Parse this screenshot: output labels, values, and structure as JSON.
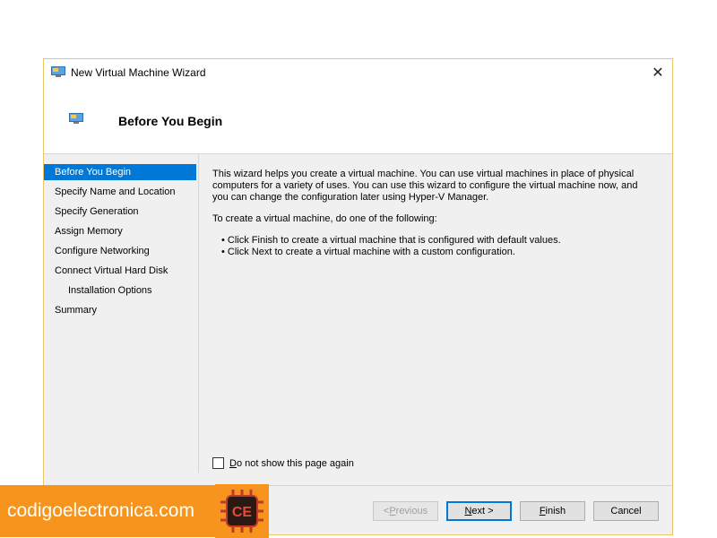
{
  "window": {
    "title": "New Virtual Machine Wizard",
    "close_glyph": "✕",
    "title_icon": "monitor-icon"
  },
  "header": {
    "title": "Before You Begin",
    "icon": "monitor-icon"
  },
  "steps": [
    {
      "label": "Before You Begin",
      "active": true
    },
    {
      "label": "Specify Name and Location"
    },
    {
      "label": "Specify Generation"
    },
    {
      "label": "Assign Memory"
    },
    {
      "label": "Configure Networking"
    },
    {
      "label": "Connect Virtual Hard Disk"
    },
    {
      "label": "Installation Options",
      "indent": true
    },
    {
      "label": "Summary"
    }
  ],
  "content": {
    "intro": "This wizard helps you create a virtual machine. You can use virtual machines in place of physical computers for a variety of uses. You can use this wizard to configure the virtual machine now, and you can change the configuration later using Hyper-V Manager.",
    "instruction": "To create a virtual machine, do one of the following:",
    "bullets": [
      "Click Finish to create a virtual machine that is configured with default values.",
      "Click Next to create a virtual machine with a custom configuration."
    ]
  },
  "checkbox": {
    "mnemonic": "D",
    "label_rest": "o not show this page again",
    "checked": false
  },
  "buttons": {
    "previous": {
      "prefix": "< ",
      "mnemonic": "P",
      "rest": "revious",
      "enabled": false
    },
    "next": {
      "mnemonic": "N",
      "rest": "ext >",
      "default": true
    },
    "finish": {
      "mnemonic": "F",
      "rest": "inish"
    },
    "cancel": {
      "label": "Cancel"
    }
  },
  "watermark": {
    "text": "codigoelectronica.com",
    "logo_text": "CE",
    "colors": {
      "orange": "#f7941d",
      "chip": "#c0392b"
    }
  },
  "colors": {
    "accent": "#0078d7",
    "border": "#e8c76a"
  }
}
